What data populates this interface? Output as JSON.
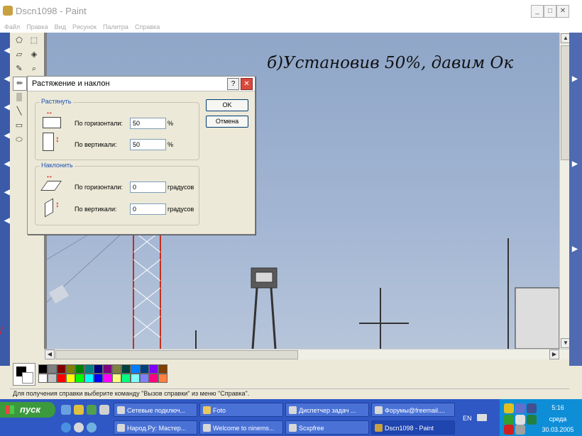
{
  "window": {
    "title": "Dscn1098 - Paint",
    "controls": {
      "minimize": "_",
      "maximize": "□",
      "close": "✕"
    }
  },
  "menu": [
    "Файл",
    "Правка",
    "Вид",
    "Рисунок",
    "Палитра",
    "Справка"
  ],
  "canvas_overlay_text": "б)Установив 50%, давим Ок",
  "dialog": {
    "title": "Растяжение и наклон",
    "help_label": "?",
    "close_label": "✕",
    "stretch_group": {
      "title": "Растянуть",
      "horizontal_label": "По горизонтали:",
      "horizontal_value": "50",
      "horizontal_unit": "%",
      "vertical_label": "По вертикали:",
      "vertical_value": "50",
      "vertical_unit": "%"
    },
    "skew_group": {
      "title": "Наклонить",
      "horizontal_label": "По горизонтали:",
      "horizontal_value": "0",
      "horizontal_unit": "градусов",
      "vertical_label": "По вертикали:",
      "vertical_value": "0",
      "vertical_unit": "градусов"
    },
    "ok_label": "OK",
    "cancel_label": "Отмена"
  },
  "palette_colors": [
    "#000000",
    "#808080",
    "#800000",
    "#808000",
    "#008000",
    "#008080",
    "#000080",
    "#800080",
    "#808040",
    "#004040",
    "#0080ff",
    "#004080",
    "#8000ff",
    "#804000",
    "#ffffff",
    "#c0c0c0",
    "#ff0000",
    "#ffff00",
    "#00ff00",
    "#00ffff",
    "#0000ff",
    "#ff00ff",
    "#ffff80",
    "#00ff80",
    "#80ffff",
    "#8080ff",
    "#ff0080",
    "#ff8040"
  ],
  "status_text": "Для получения справки выберите команду \"Вызов справки\" из меню \"Справка\".",
  "taskbar": {
    "start_label": "пуск",
    "row1": [
      "Сетевые подключ...",
      "Foto",
      "Диспетчер задач ...",
      "Форумы@freemail...."
    ],
    "row2": [
      "Народ.Ру: Мастер...",
      "Welcome to ninems...",
      "Scxpfree",
      "Dscn1098 - Paint"
    ],
    "active_item": "Dscn1098 - Paint",
    "language": "EN",
    "clock": "5:16",
    "day": "среда",
    "date": "30.03.2005"
  }
}
